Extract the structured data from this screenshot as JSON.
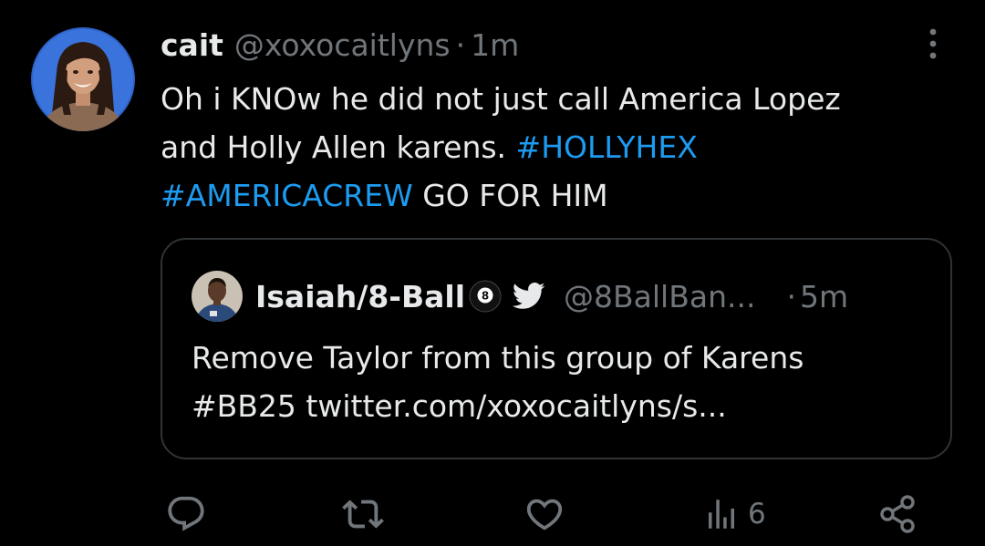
{
  "tweet": {
    "author": {
      "name": "cait",
      "handle": "@xoxocaitlyns",
      "separator": "·",
      "time": "1m",
      "avatar": "profile-photo"
    },
    "text_lines": [
      {
        "plain": "Oh i KNOw he did not just call America Lopez"
      },
      {
        "plain": "and Holly Allen karens. ",
        "hashtag": "#HOLLYHEX"
      },
      {
        "hashtag": "#AMERICACREW",
        "plain": " GO FOR HIM"
      }
    ],
    "more_icon": "more-vertical-icon"
  },
  "quote": {
    "author": {
      "name": "Isaiah/8-Ball",
      "emoji": "8-ball",
      "badge_icon": "twitter-bird-icon",
      "handle": "@8BallBan...",
      "separator": "·",
      "time": "5m"
    },
    "text_lines": [
      "Remove Taylor from this group of Karens",
      "#BB25 twitter.com/xoxocaitlyns/s..."
    ]
  },
  "actions": {
    "reply": {
      "icon": "reply-icon",
      "count": ""
    },
    "retweet": {
      "icon": "retweet-icon",
      "count": ""
    },
    "like": {
      "icon": "heart-icon",
      "count": ""
    },
    "views": {
      "icon": "views-icon",
      "count": "6"
    },
    "share": {
      "icon": "share-icon",
      "count": ""
    }
  },
  "colors": {
    "background": "#000000",
    "text": "#e7e9ea",
    "muted": "#71767b",
    "link": "#1d9bf0",
    "border": "#2f3336"
  }
}
